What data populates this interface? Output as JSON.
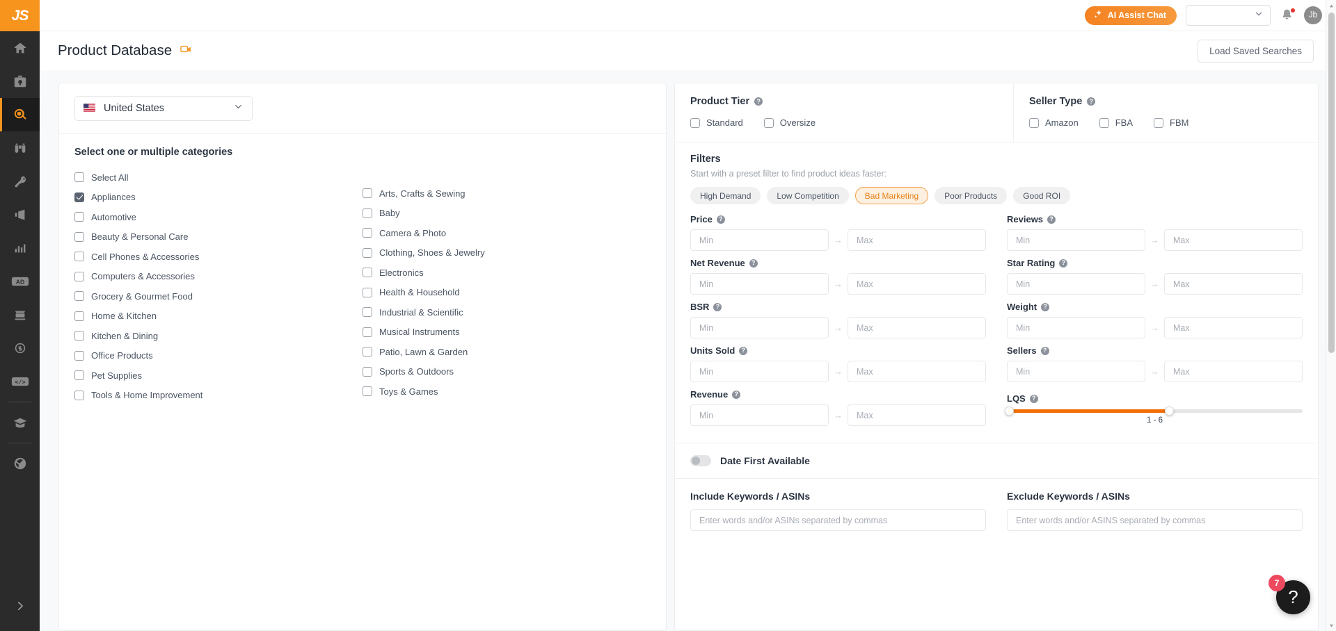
{
  "sidebar": {
    "logo": "JS",
    "items": [
      {
        "name": "home",
        "icon": "home-icon"
      },
      {
        "name": "toolbox",
        "icon": "toolbox-icon"
      },
      {
        "name": "product-research",
        "icon": "magnifier-icon",
        "active": true
      },
      {
        "name": "product-database",
        "icon": "binoculars-icon"
      },
      {
        "name": "keyword-research",
        "icon": "key-icon"
      },
      {
        "name": "marketing",
        "icon": "megaphone-icon"
      },
      {
        "name": "analytics",
        "icon": "bar-chart-icon"
      },
      {
        "name": "advertising",
        "icon": "ad-icon"
      },
      {
        "name": "inventory",
        "icon": "box-refresh-icon"
      },
      {
        "name": "finance",
        "icon": "dollar-refresh-icon"
      },
      {
        "name": "developer",
        "icon": "code-icon"
      },
      {
        "name": "academy",
        "icon": "graduation-cap-icon"
      },
      {
        "name": "extension",
        "icon": "globe-icon"
      }
    ],
    "expand_label": "expand-sidebar"
  },
  "header": {
    "ai_chat_label": "AI Assist Chat",
    "account_select_value": "",
    "notification_badge": true,
    "avatar_initials": "Jb"
  },
  "page": {
    "title": "Product Database",
    "video_icon": "video-camera-icon",
    "load_saved_label": "Load Saved Searches"
  },
  "marketplace": {
    "flag": "🇺🇸",
    "value": "United States"
  },
  "categories": {
    "heading": "Select one or multiple categories",
    "left": [
      {
        "label": "Select All",
        "checked": false
      },
      {
        "label": "Appliances",
        "checked": true
      },
      {
        "label": "Automotive",
        "checked": false
      },
      {
        "label": "Beauty & Personal Care",
        "checked": false
      },
      {
        "label": "Cell Phones & Accessories",
        "checked": false
      },
      {
        "label": "Computers & Accessories",
        "checked": false
      },
      {
        "label": "Grocery & Gourmet Food",
        "checked": false
      },
      {
        "label": "Home & Kitchen",
        "checked": false
      },
      {
        "label": "Kitchen & Dining",
        "checked": false
      },
      {
        "label": "Office Products",
        "checked": false
      },
      {
        "label": "Pet Supplies",
        "checked": false
      },
      {
        "label": "Tools & Home Improvement",
        "checked": false
      }
    ],
    "right": [
      {
        "label": "Arts, Crafts & Sewing",
        "checked": false
      },
      {
        "label": "Baby",
        "checked": false
      },
      {
        "label": "Camera & Photo",
        "checked": false
      },
      {
        "label": "Clothing, Shoes & Jewelry",
        "checked": false
      },
      {
        "label": "Electronics",
        "checked": false
      },
      {
        "label": "Health & Household",
        "checked": false
      },
      {
        "label": "Industrial & Scientific",
        "checked": false
      },
      {
        "label": "Musical Instruments",
        "checked": false
      },
      {
        "label": "Patio, Lawn & Garden",
        "checked": false
      },
      {
        "label": "Sports & Outdoors",
        "checked": false
      },
      {
        "label": "Toys & Games",
        "checked": false
      }
    ]
  },
  "product_tier": {
    "title": "Product Tier",
    "options": [
      {
        "label": "Standard",
        "checked": false
      },
      {
        "label": "Oversize",
        "checked": false
      }
    ]
  },
  "seller_type": {
    "title": "Seller Type",
    "options": [
      {
        "label": "Amazon",
        "checked": false
      },
      {
        "label": "FBA",
        "checked": false
      },
      {
        "label": "FBM",
        "checked": false
      }
    ]
  },
  "filters": {
    "title": "Filters",
    "subtitle": "Start with a preset filter to find product ideas faster:",
    "presets": [
      {
        "label": "High Demand",
        "selected": false
      },
      {
        "label": "Low Competition",
        "selected": false
      },
      {
        "label": "Bad Marketing",
        "selected": true
      },
      {
        "label": "Poor Products",
        "selected": false
      },
      {
        "label": "Good ROI",
        "selected": false
      }
    ],
    "min_placeholder": "Min",
    "max_placeholder": "Max",
    "left_fields": [
      {
        "label": "Price",
        "min": "",
        "max": ""
      },
      {
        "label": "Net Revenue",
        "min": "",
        "max": ""
      },
      {
        "label": "BSR",
        "min": "",
        "max": ""
      },
      {
        "label": "Units Sold",
        "min": "",
        "max": ""
      },
      {
        "label": "Revenue",
        "min": "",
        "max": ""
      }
    ],
    "right_fields": [
      {
        "label": "Reviews",
        "min": "",
        "max": ""
      },
      {
        "label": "Star Rating",
        "min": "",
        "max": ""
      },
      {
        "label": "Weight",
        "min": "",
        "max": ""
      },
      {
        "label": "Sellers",
        "min": "",
        "max": ""
      }
    ],
    "lqs": {
      "label": "LQS",
      "value_text": "1 - 6",
      "min": 1,
      "max": 6,
      "fill_percent": 55
    }
  },
  "date_first_available": {
    "label": "Date First Available",
    "enabled": false
  },
  "keywords": {
    "include_label": "Include Keywords / ASINs",
    "include_placeholder": "Enter words and/or ASINs separated by commas",
    "include_value": "",
    "exclude_label": "Exclude Keywords / ASINs",
    "exclude_placeholder": "Enter words and/or ASINS separated by commas",
    "exclude_value": ""
  },
  "help": {
    "glyph": "?",
    "badge": "7"
  },
  "colors": {
    "brand_orange": "#f7941e",
    "slider_orange": "#f26e00",
    "sidebar_bg": "#2b2b2b",
    "badge_red": "#ee4a5f"
  }
}
